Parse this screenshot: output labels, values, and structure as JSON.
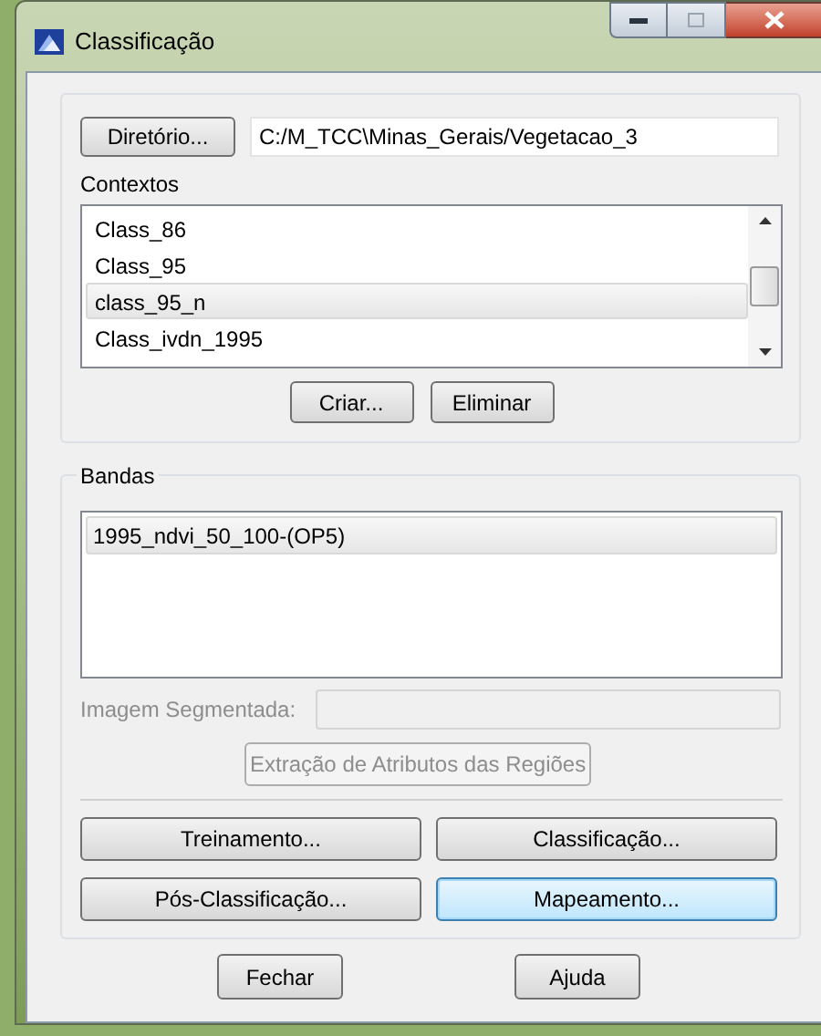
{
  "window": {
    "title": "Classificação"
  },
  "directory": {
    "button": "Diretório...",
    "value": "C:/M_TCC\\Minas_Gerais/Vegetacao_3"
  },
  "contexts": {
    "label": "Contextos",
    "items": [
      {
        "label": "Class_86",
        "selected": false
      },
      {
        "label": "Class_95",
        "selected": false
      },
      {
        "label": "class_95_n",
        "selected": true
      },
      {
        "label": "Class_ivdn_1995",
        "selected": false
      }
    ],
    "buttons": [
      "Criar...",
      "Eliminar"
    ]
  },
  "bands": {
    "label": "Bandas",
    "items": [
      {
        "label": "1995_ndvi_50_100-(OP5)",
        "selected": true
      }
    ],
    "segmented_label": "Imagem Segmentada:",
    "segmented_disabled": true,
    "extract_button": {
      "label": "Extração de Atributos das Regiões",
      "disabled": true
    },
    "actions": [
      {
        "label": "Treinamento...",
        "focused": false
      },
      {
        "label": "Classificação...",
        "focused": false
      },
      {
        "label": "Pós-Classificação...",
        "focused": false
      },
      {
        "label": "Mapeamento...",
        "focused": true
      }
    ]
  },
  "footer_buttons": [
    "Fechar",
    "Ajuda"
  ]
}
